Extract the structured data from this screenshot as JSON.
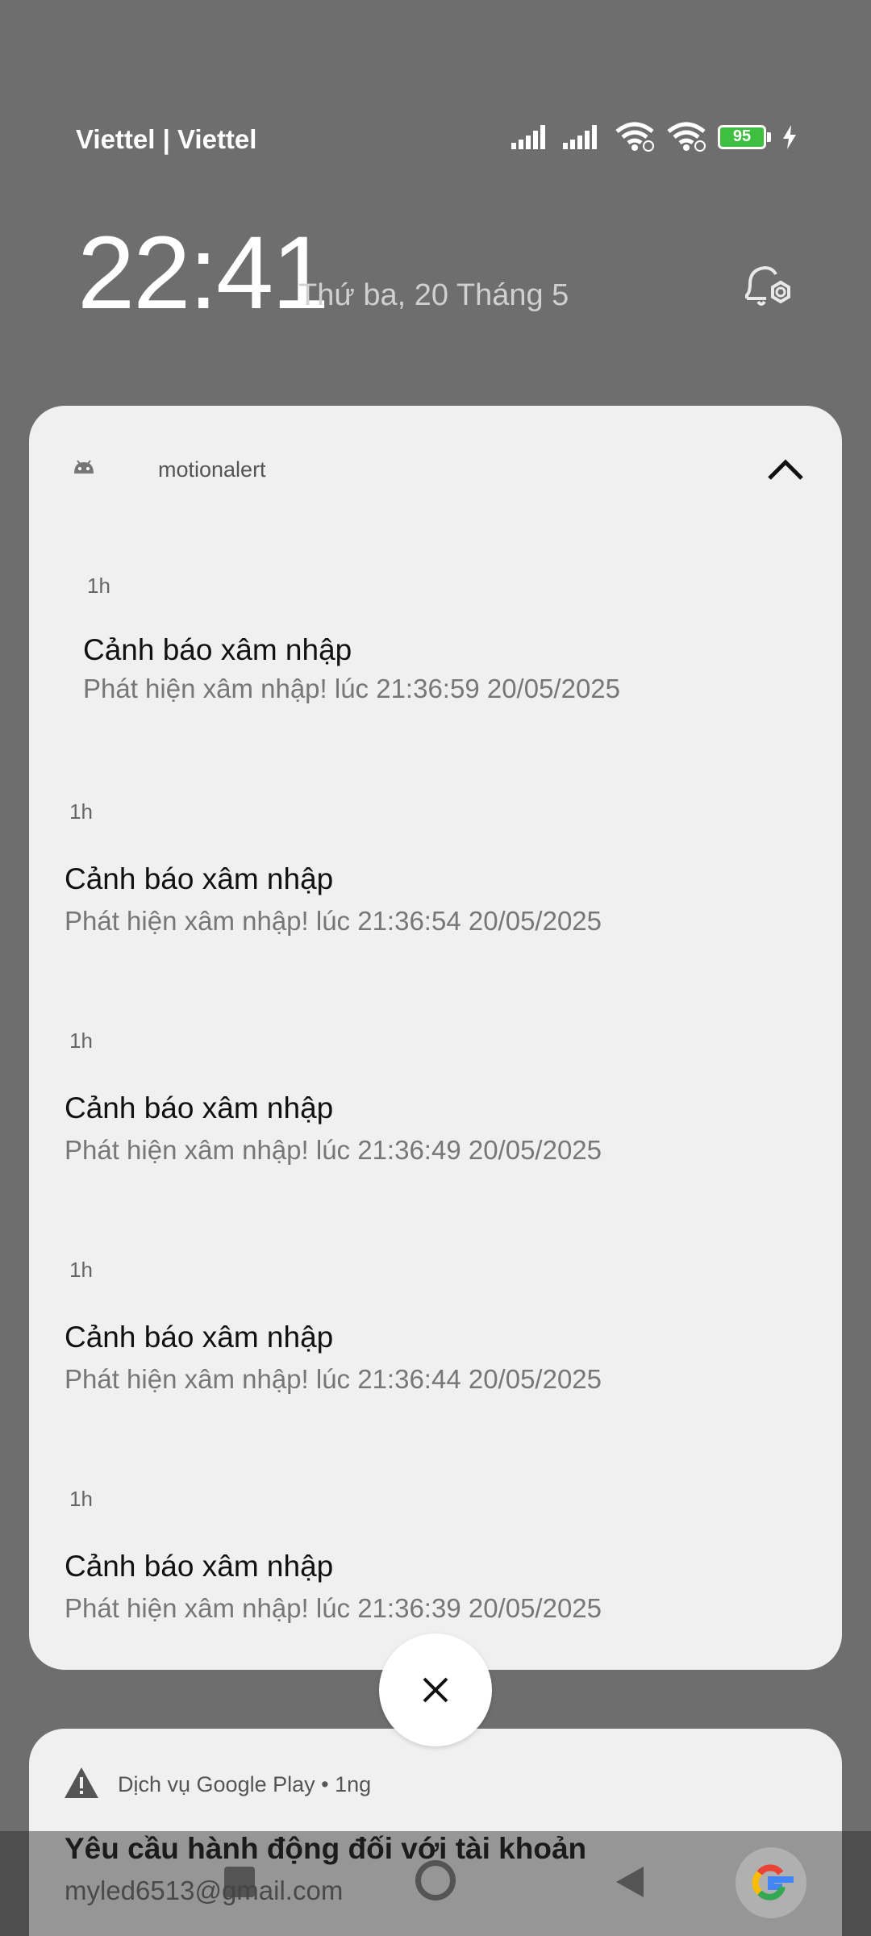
{
  "status_bar": {
    "carrier": "Viettel | Viettel",
    "battery": "95",
    "icons": [
      "signal-1-icon",
      "signal-2-icon",
      "wifi-icon",
      "wifi-2-icon",
      "battery-icon",
      "charging-icon"
    ]
  },
  "lockscreen": {
    "time": "22:41",
    "date": "Thứ ba, 20 Tháng 5"
  },
  "group": {
    "app_name": "motionalert",
    "notifications": [
      {
        "time": "1h",
        "title": "Cảnh báo xâm nhập",
        "body": "Phát hiện xâm nhập! lúc 21:36:59 20/05/2025"
      },
      {
        "time": "1h",
        "title": "Cảnh báo xâm nhập",
        "body": "Phát hiện xâm nhập! lúc 21:36:54 20/05/2025"
      },
      {
        "time": "1h",
        "title": "Cảnh báo xâm nhập",
        "body": "Phát hiện xâm nhập! lúc 21:36:49 20/05/2025"
      },
      {
        "time": "1h",
        "title": "Cảnh báo xâm nhập",
        "body": "Phát hiện xâm nhập! lúc 21:36:44 20/05/2025"
      },
      {
        "time": "1h",
        "title": "Cảnh báo xâm nhập",
        "body": "Phát hiện xâm nhập! lúc 21:36:39 20/05/2025"
      }
    ]
  },
  "google_play_notification": {
    "header": "Dịch vụ Google Play  •  1ng",
    "title": "Yêu cầu hành động đối với tài khoản",
    "body": "myled6513@gmail.com"
  },
  "colors": {
    "background": "#6e6e6e",
    "card": "#f0f0f0",
    "battery_green": "#3fbf3f"
  }
}
